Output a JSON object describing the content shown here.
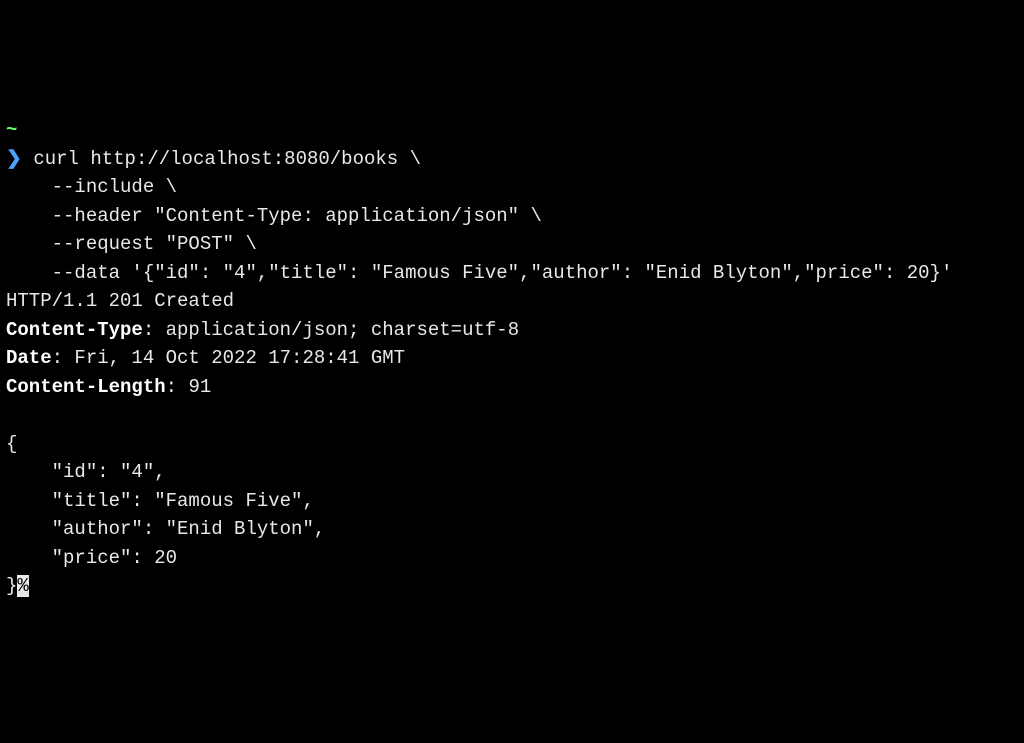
{
  "tilde": "~",
  "prompt": "❯",
  "cmd": {
    "line1": "curl http://localhost:8080/books \\",
    "line2": "    --include \\",
    "line3": "    --header \"Content-Type: application/json\" \\",
    "line4": "    --request \"POST\" \\",
    "line5": "    --data '{\"id\": \"4\",\"title\": \"Famous Five\",\"author\": \"Enid Blyton\",\"price\": 20}'"
  },
  "status_line": "HTTP/1.1 201 Created",
  "headers": {
    "ct_key": "Content-Type",
    "ct_val": ": application/json; charset=utf-8",
    "date_key": "Date",
    "date_val": ": Fri, 14 Oct 2022 17:28:41 GMT",
    "cl_key": "Content-Length",
    "cl_val": ": 91"
  },
  "body": {
    "open": "{",
    "l1": "    \"id\": \"4\",",
    "l2": "    \"title\": \"Famous Five\",",
    "l3": "    \"author\": \"Enid Blyton\",",
    "l4": "    \"price\": 20",
    "close": "}",
    "percent": "%"
  }
}
